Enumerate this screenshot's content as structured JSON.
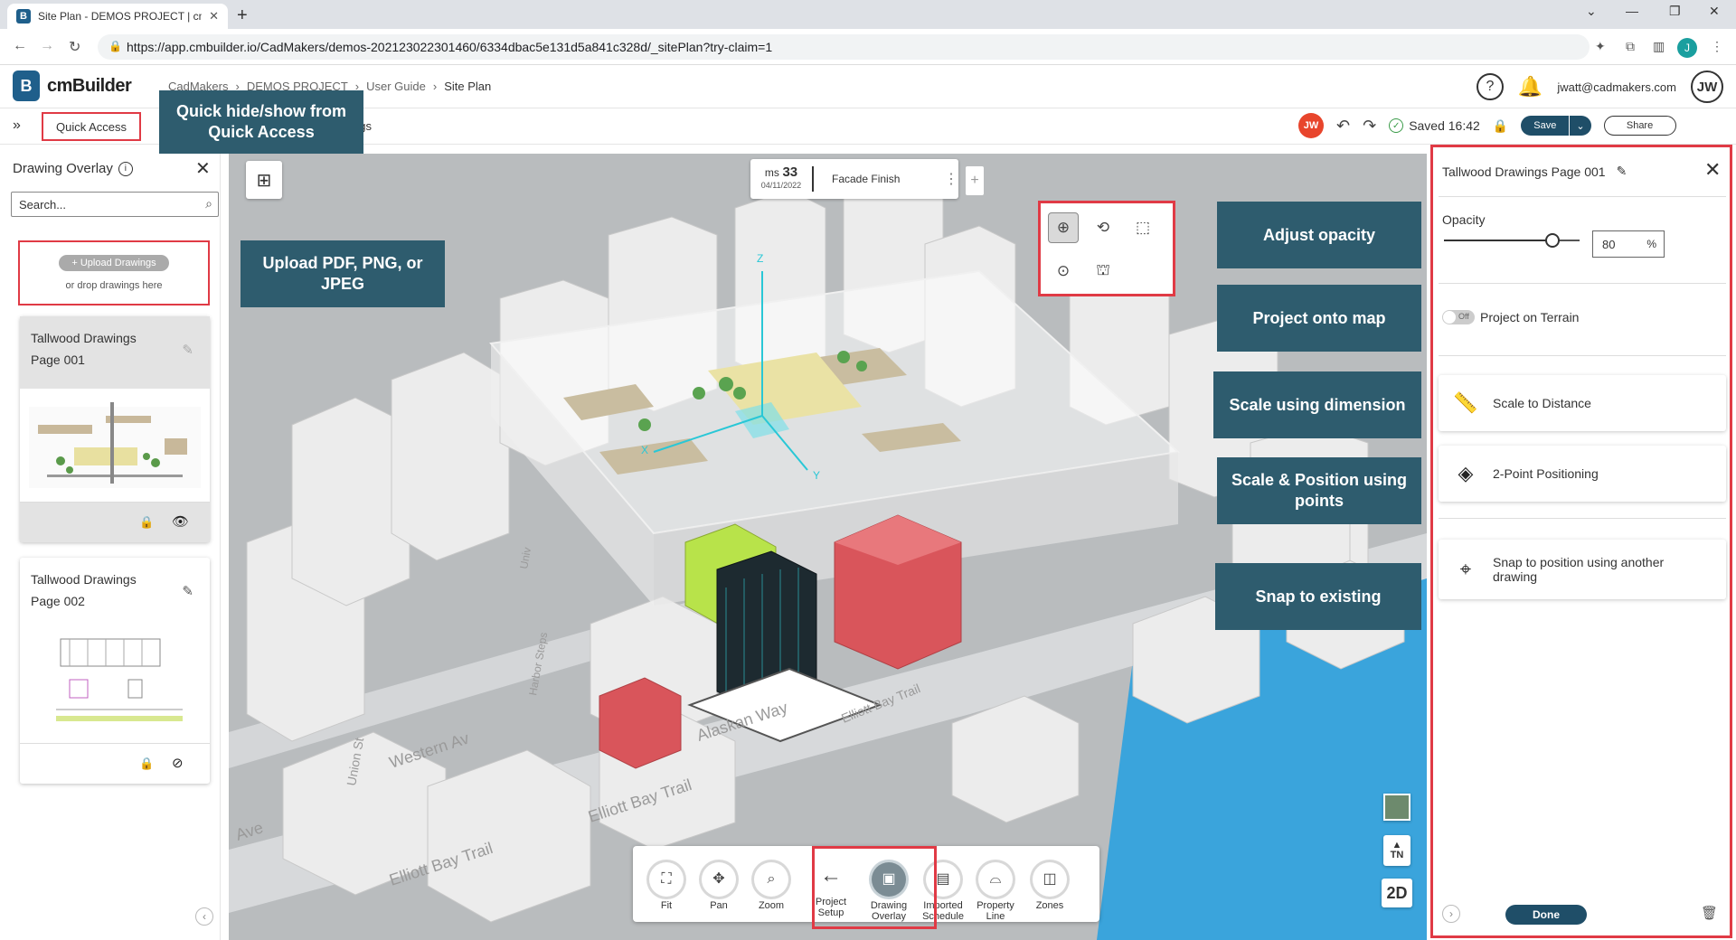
{
  "browser": {
    "tab_title": "Site Plan - DEMOS PROJECT | cm",
    "favicon": "B",
    "url": "https://app.cmbuilder.io/CadMakers/demos-202123022301460/6334dbac5e131d5a841c328d/_sitePlan?try-claim=1",
    "profile_initial": "J"
  },
  "header": {
    "logo_mark": "B",
    "brand": "cmBuilder",
    "breadcrumb": [
      "CadMakers",
      "DEMOS PROJECT",
      "User Guide",
      "Site Plan"
    ],
    "email": "jwatt@cadmakers.com",
    "avatar": "JW"
  },
  "toolbar": {
    "quick_access_label": "Quick Access",
    "drawings_tab_partial": "ngs",
    "user_badge": "JW",
    "saved_text": "Saved 16:42",
    "save_label": "Save",
    "share_label": "Share"
  },
  "left_panel": {
    "title": "Drawing Overlay",
    "search_placeholder": "Search...",
    "upload_button": "+ Upload Drawings",
    "upload_hint": "or drop drawings here",
    "drawings": [
      {
        "title_line1": "Tallwood Drawings",
        "title_line2": "Page 001",
        "visible": true
      },
      {
        "title_line1": "Tallwood Drawings",
        "title_line2": "Page 002",
        "visible": false
      }
    ]
  },
  "schedule": {
    "ms_label": "ms",
    "ms_number": "33",
    "date": "04/11/2022",
    "task": "Facade Finish"
  },
  "callouts": {
    "quick_access": "Quick hide/show from Quick Access",
    "upload": "Upload PDF, PNG, or JPEG",
    "adjust_opacity": "Adjust opacity",
    "project_map": "Project onto map",
    "scale_dimension": "Scale using dimension",
    "scale_position": "Scale & Position using points",
    "snap": "Snap to existing"
  },
  "map": {
    "street_labels": [
      "Alaskan Way",
      "Elliott Bay Trail",
      "Elliott Bay Trail",
      "Elliott Bay Trail",
      "Union St",
      "Western Av",
      "Ave",
      "Univ",
      "Harbor Steps"
    ],
    "axis_labels": [
      "Z",
      "X",
      "Y"
    ],
    "north_label": "TN",
    "view_mode": "2D"
  },
  "bottom_bar": {
    "tools": [
      {
        "label": "Fit",
        "icon": "fit-icon"
      },
      {
        "label": "Pan",
        "icon": "pan-icon"
      },
      {
        "label": "Zoom",
        "icon": "zoom-icon"
      }
    ],
    "project_setup": "Project Setup",
    "nav": [
      {
        "label": "Drawing Overlay",
        "icon": "drawing-overlay-icon"
      },
      {
        "label": "Imported Schedule",
        "icon": "schedule-icon"
      },
      {
        "label": "Property Line",
        "icon": "property-line-icon"
      },
      {
        "label": "Zones",
        "icon": "zones-icon"
      }
    ]
  },
  "right_panel": {
    "title": "Tallwood Drawings Page 001",
    "opacity_label": "Opacity",
    "opacity_value": "80",
    "opacity_unit": "%",
    "opacity_fraction": 0.8,
    "terrain_toggle": "Off",
    "terrain_label": "Project on Terrain",
    "actions": [
      {
        "label": "Scale to Distance",
        "icon": "ruler-icon"
      },
      {
        "label": "2-Point Positioning",
        "icon": "layers-icon"
      },
      {
        "label": "Snap to position using another drawing",
        "icon": "map-pin-icon"
      }
    ],
    "done_label": "Done"
  },
  "colors": {
    "accent": "#1f4e68",
    "callout": "#2e5c6e",
    "highlight": "#e03a45",
    "building_red": "#d9555b",
    "building_green": "#b8e34a",
    "water": "#3aa4dc"
  }
}
